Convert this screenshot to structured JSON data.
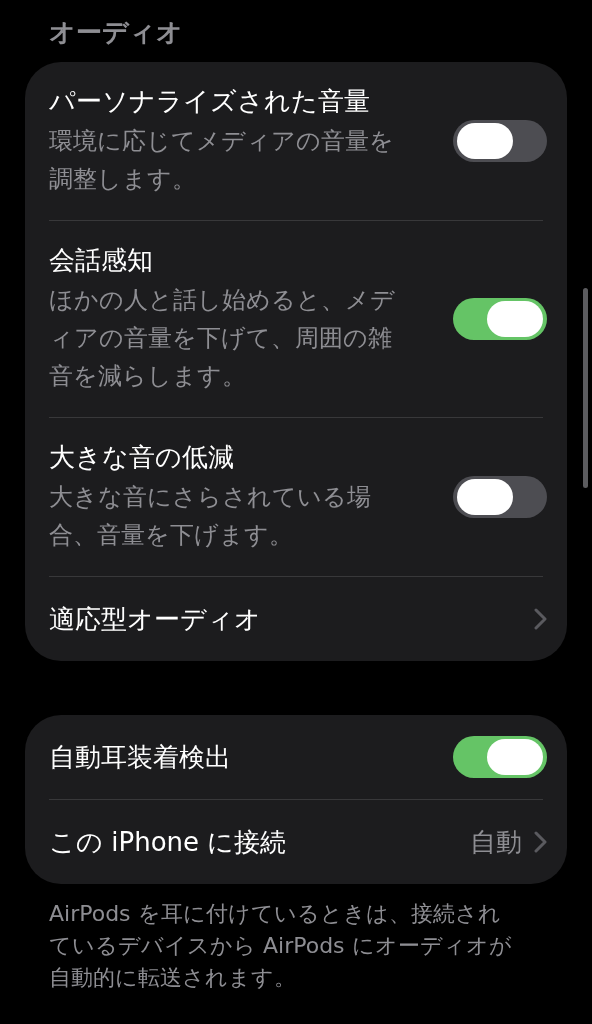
{
  "section_header": "オーディオ",
  "groups": [
    {
      "rows": [
        {
          "kind": "toggle",
          "title": "パーソナライズされた音量",
          "subtitle": "環境に応じてメディアの音量を調整します。",
          "on": false
        },
        {
          "kind": "toggle",
          "title": "会話感知",
          "subtitle": "ほかの人と話し始めると、メディアの音量を下げて、周囲の雑音を減らします。",
          "on": true
        },
        {
          "kind": "toggle",
          "title": "大きな音の低減",
          "subtitle": "大きな音にさらされている場合、音量を下げます。",
          "on": false
        },
        {
          "kind": "link",
          "title": "適応型オーディオ"
        }
      ]
    },
    {
      "rows": [
        {
          "kind": "toggle",
          "title": "自動耳装着検出",
          "on": true
        },
        {
          "kind": "link",
          "title": "この iPhone に接続",
          "value": "自動"
        }
      ],
      "footer": "AirPods を耳に付けているときは、接続されているデバイスから AirPods にオーディオが自動的に転送されます。"
    }
  ]
}
